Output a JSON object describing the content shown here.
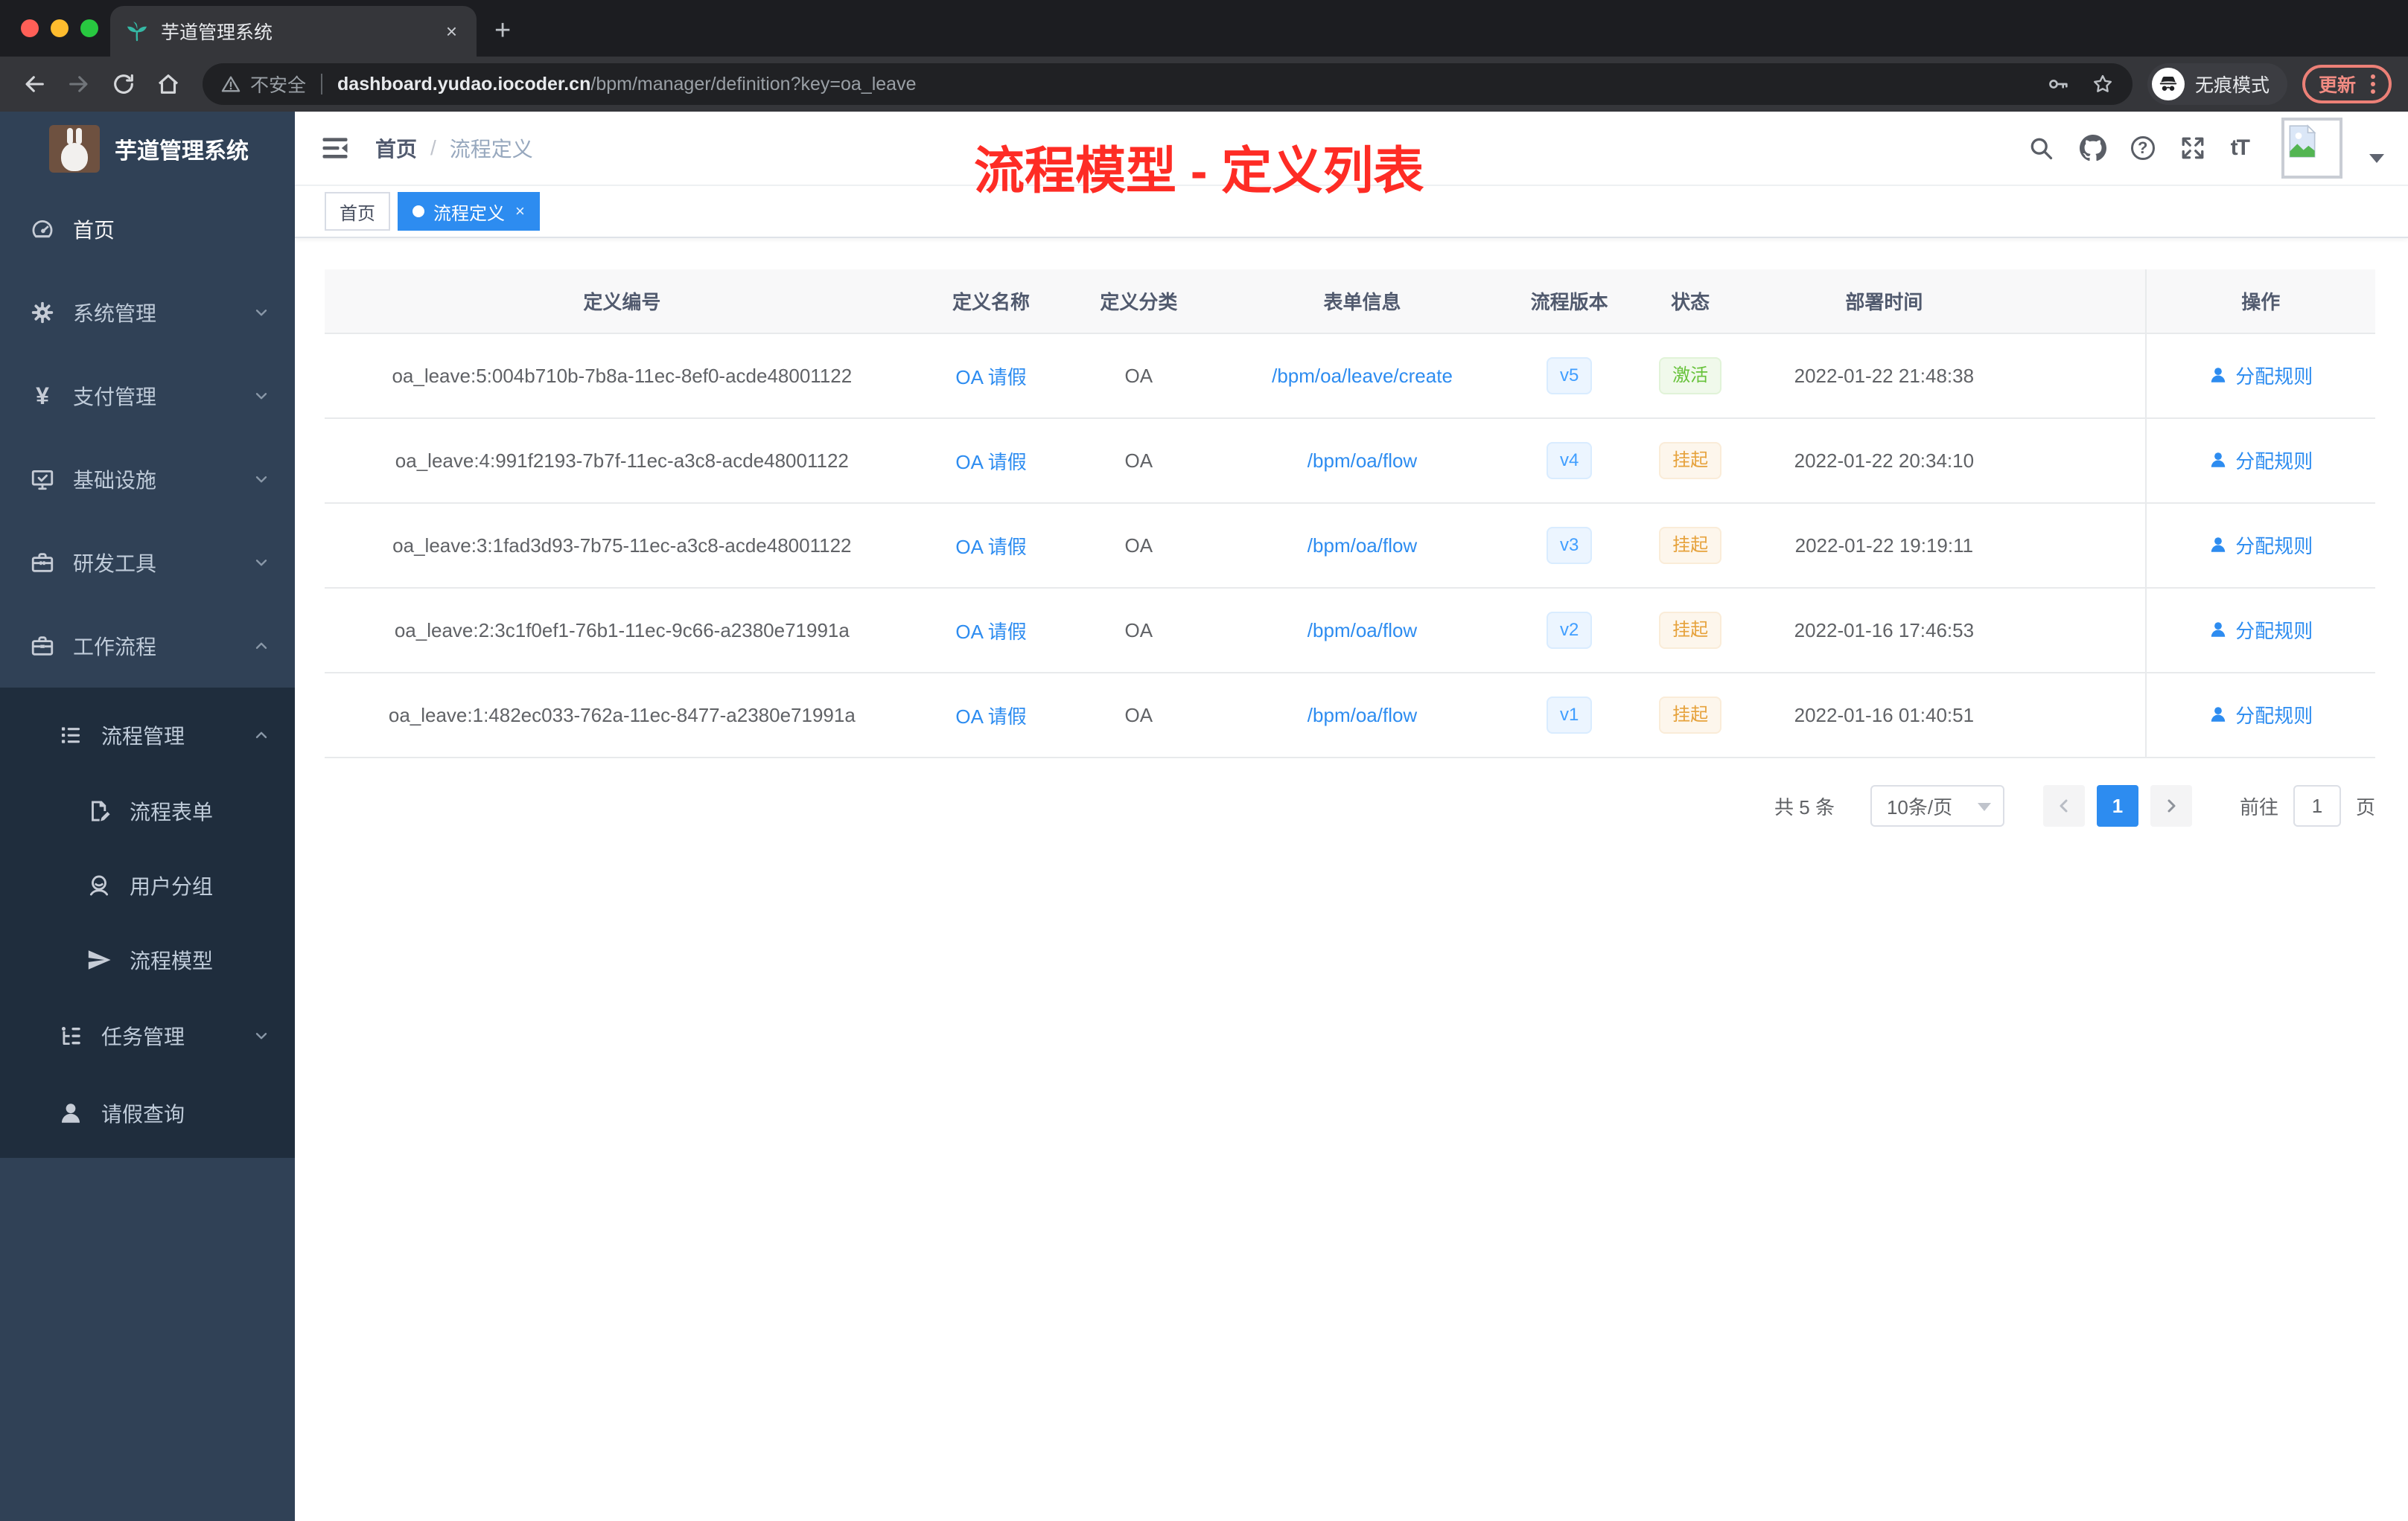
{
  "colors": {
    "accent_blue": "#2d8cf0",
    "badge_blue": "#409eff",
    "success_green": "#67c23a",
    "warning_orange": "#e6a23c",
    "annotation_red": "#fe2c25",
    "sidebar_bg": "#304156",
    "submenu_bg": "#1f2d3d"
  },
  "icons": {
    "yen": "¥",
    "help": "?",
    "font_size": "tT"
  },
  "browser": {
    "tab_title": "芋道管理系统",
    "tab_close": "×",
    "new_tab": "+",
    "security_label": "不安全",
    "url_host": "dashboard.yudao.iocoder.cn",
    "url_path": "/bpm/manager/definition?key=oa_leave",
    "incognito_label": "无痕模式",
    "update_label": "更新"
  },
  "sidebar": {
    "app_title": "芋道管理系统",
    "items": [
      {
        "label": "首页",
        "icon": "dashboard-icon"
      },
      {
        "label": "系统管理",
        "icon": "gear-icon",
        "expand": "down"
      },
      {
        "label": "支付管理",
        "icon": "yen-icon",
        "expand": "down"
      },
      {
        "label": "基础设施",
        "icon": "monitor-icon",
        "expand": "down"
      },
      {
        "label": "研发工具",
        "icon": "toolbox-icon",
        "expand": "down"
      },
      {
        "label": "工作流程",
        "icon": "suitcase-icon",
        "expand": "up"
      },
      {
        "label": "流程管理",
        "icon": "list-icon",
        "expand": "up"
      },
      {
        "label": "流程表单",
        "icon": "form-icon"
      },
      {
        "label": "用户分组",
        "icon": "user-group-icon"
      },
      {
        "label": "流程模型",
        "icon": "paper-plane-icon"
      },
      {
        "label": "任务管理",
        "icon": "tree-icon",
        "expand": "down"
      },
      {
        "label": "请假查询",
        "icon": "user-icon"
      }
    ]
  },
  "navbar": {
    "breadcrumb": [
      "首页",
      "流程定义"
    ],
    "separator": "/"
  },
  "annotation": {
    "text": "流程模型 - 定义列表"
  },
  "tags": [
    {
      "label": "首页",
      "active": false
    },
    {
      "label": "流程定义",
      "active": true,
      "close": "×"
    }
  ],
  "table": {
    "columns": [
      "定义编号",
      "定义名称",
      "定义分类",
      "表单信息",
      "流程版本",
      "状态",
      "部署时间",
      "操作"
    ],
    "rows": [
      {
        "id": "oa_leave:5:004b710b-7b8a-11ec-8ef0-acde48001122",
        "name": "OA 请假",
        "category": "OA",
        "form": "/bpm/oa/leave/create",
        "version": "v5",
        "status": "激活",
        "status_type": "active",
        "time": "2022-01-22 21:48:38",
        "action": "分配规则"
      },
      {
        "id": "oa_leave:4:991f2193-7b7f-11ec-a3c8-acde48001122",
        "name": "OA 请假",
        "category": "OA",
        "form": "/bpm/oa/flow",
        "version": "v4",
        "status": "挂起",
        "status_type": "suspended",
        "time": "2022-01-22 20:34:10",
        "action": "分配规则"
      },
      {
        "id": "oa_leave:3:1fad3d93-7b75-11ec-a3c8-acde48001122",
        "name": "OA 请假",
        "category": "OA",
        "form": "/bpm/oa/flow",
        "version": "v3",
        "status": "挂起",
        "status_type": "suspended",
        "time": "2022-01-22 19:19:11",
        "action": "分配规则"
      },
      {
        "id": "oa_leave:2:3c1f0ef1-76b1-11ec-9c66-a2380e71991a",
        "name": "OA 请假",
        "category": "OA",
        "form": "/bpm/oa/flow",
        "version": "v2",
        "status": "挂起",
        "status_type": "suspended",
        "time": "2022-01-16 17:46:53",
        "action": "分配规则"
      },
      {
        "id": "oa_leave:1:482ec033-762a-11ec-8477-a2380e71991a",
        "name": "OA 请假",
        "category": "OA",
        "form": "/bpm/oa/flow",
        "version": "v1",
        "status": "挂起",
        "status_type": "suspended",
        "time": "2022-01-16 01:40:51",
        "action": "分配规则"
      }
    ]
  },
  "pagination": {
    "total": "共 5 条",
    "page_size": "10条/页",
    "current_page": "1",
    "goto_label": "前往",
    "goto_value": "1",
    "page_unit": "页"
  }
}
